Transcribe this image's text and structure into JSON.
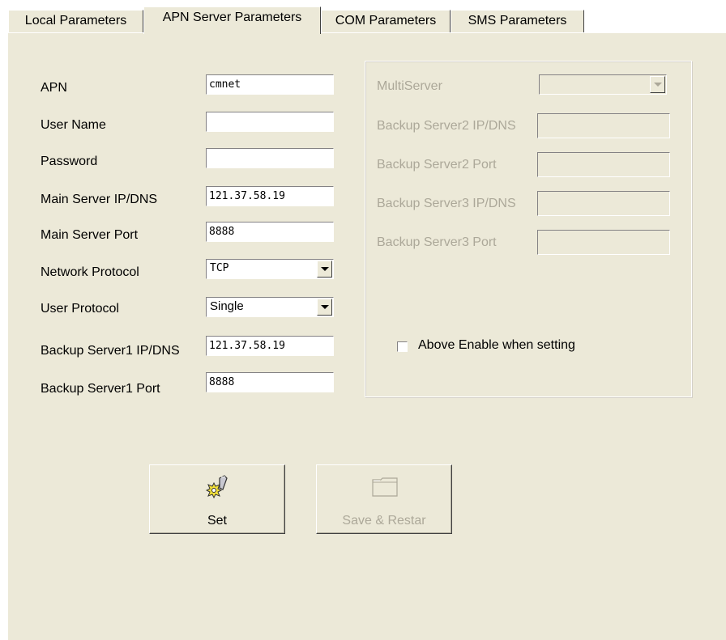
{
  "tabs": [
    {
      "label": "Local Parameters"
    },
    {
      "label": "APN Server Parameters"
    },
    {
      "label": "COM Parameters"
    },
    {
      "label": "SMS Parameters"
    }
  ],
  "active_tab": "APN Server Parameters",
  "left_form": {
    "apn": {
      "label": "APN",
      "value": "cmnet"
    },
    "user_name": {
      "label": "User Name",
      "value": ""
    },
    "password": {
      "label": "Password",
      "value": ""
    },
    "main_server_ip": {
      "label": "Main Server IP/DNS",
      "value": "121.37.58.19"
    },
    "main_server_port": {
      "label": "Main Server Port",
      "value": "8888"
    },
    "network_protocol": {
      "label": "Network Protocol",
      "value": "TCP"
    },
    "user_protocol": {
      "label": "User Protocol",
      "value": "Single"
    },
    "backup_server1_ip": {
      "label": "Backup Server1 IP/DNS",
      "value": "121.37.58.19"
    },
    "backup_server1_port": {
      "label": "Backup Server1 Port",
      "value": "8888"
    }
  },
  "right_group": {
    "multiserver": {
      "label": "MultiServer",
      "value": ""
    },
    "backup_server2_ip": {
      "label": "Backup Server2 IP/DNS",
      "value": ""
    },
    "backup_server2_port": {
      "label": "Backup Server2 Port",
      "value": ""
    },
    "backup_server3_ip": {
      "label": "Backup Server3 IP/DNS",
      "value": ""
    },
    "backup_server3_port": {
      "label": "Backup Server3 Port",
      "value": ""
    },
    "enable_checkbox": {
      "label": "Above Enable when setting",
      "checked": false
    }
  },
  "buttons": {
    "set": {
      "label": "Set",
      "icon": "wrench-gear-icon"
    },
    "save_restart": {
      "label": "Save & Restar",
      "icon": "folder-icon",
      "enabled": false
    }
  },
  "colors": {
    "panel_bg": "#ece9d8",
    "disabled_text": "#aca899"
  }
}
